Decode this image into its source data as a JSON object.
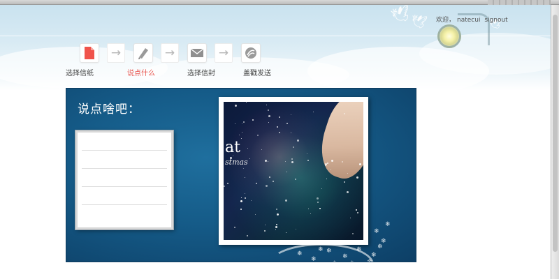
{
  "header": {
    "greeting": "欢迎，",
    "username": "natecui",
    "signout_label": "signout"
  },
  "steps": [
    {
      "label": "选择信纸",
      "icon": "document-icon",
      "active": false
    },
    {
      "label": "说点什么",
      "icon": "pen-icon",
      "active": true
    },
    {
      "label": "选择信封",
      "icon": "envelope-icon",
      "active": false
    },
    {
      "label": "盖戳发送",
      "icon": "stamp-icon",
      "active": false
    }
  ],
  "card": {
    "title": "说点啥吧：",
    "photo_text": "at",
    "photo_subtext": "stmas"
  },
  "colors": {
    "active_step": "#e8524b",
    "card_background": "#155b88",
    "document_icon": "#f0534b"
  }
}
